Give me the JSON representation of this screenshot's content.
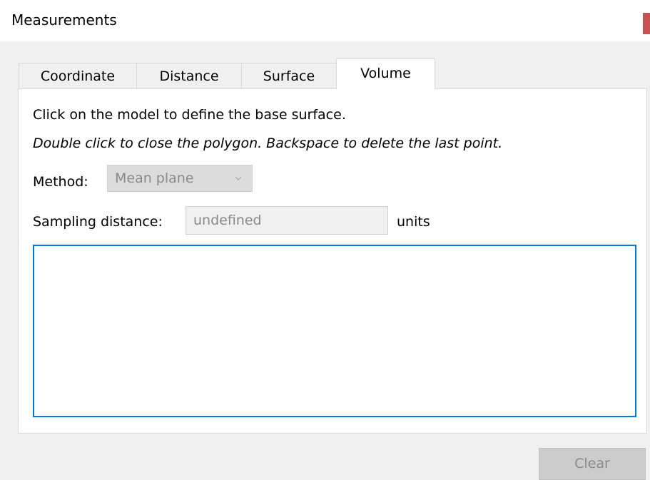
{
  "window": {
    "title": "Measurements",
    "close_color": "#c75050"
  },
  "tabs": [
    {
      "label": "Coordinate",
      "active": false
    },
    {
      "label": "Distance",
      "active": false
    },
    {
      "label": "Surface",
      "active": false
    },
    {
      "label": "Volume",
      "active": true
    }
  ],
  "volume": {
    "instruction": "Click on the model to define the base surface.",
    "hint": "Double click to close the polygon. Backspace to delete the last point.",
    "method_label": "Method:",
    "method_value": "Mean plane",
    "method_icon": "chevron-down-icon",
    "sampling_label": "Sampling distance:",
    "sampling_placeholder": "undefined",
    "units_label": "units",
    "results_text": ""
  },
  "footer": {
    "clear_label": "Clear"
  },
  "colors": {
    "accent": "#0078d7",
    "disabled_text": "#8a8a8a"
  }
}
